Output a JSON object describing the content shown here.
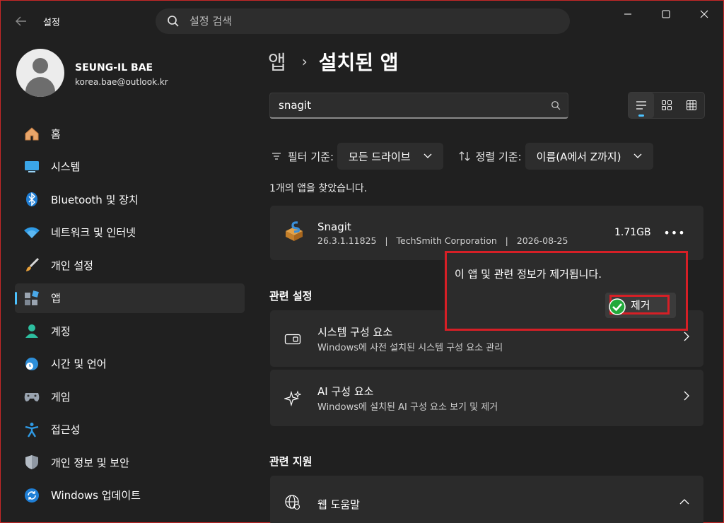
{
  "titlebar": {
    "app_title": "설정",
    "search_placeholder": "설정 검색"
  },
  "profile": {
    "name": "SEUNG-IL BAE",
    "email": "korea.bae@outlook.kr"
  },
  "sidebar": {
    "items": [
      {
        "label": "홈",
        "icon": "home-icon"
      },
      {
        "label": "시스템",
        "icon": "system-icon"
      },
      {
        "label": "Bluetooth 및 장치",
        "icon": "bluetooth-icon"
      },
      {
        "label": "네트워크 및 인터넷",
        "icon": "wifi-icon"
      },
      {
        "label": "개인 설정",
        "icon": "brush-icon"
      },
      {
        "label": "앱",
        "icon": "apps-icon",
        "active": true
      },
      {
        "label": "계정",
        "icon": "account-icon"
      },
      {
        "label": "시간 및 언어",
        "icon": "time-language-icon"
      },
      {
        "label": "게임",
        "icon": "gamepad-icon"
      },
      {
        "label": "접근성",
        "icon": "accessibility-icon"
      },
      {
        "label": "개인 정보 및 보안",
        "icon": "shield-icon"
      },
      {
        "label": "Windows 업데이트",
        "icon": "update-icon"
      }
    ]
  },
  "breadcrumb": {
    "parent": "앱",
    "separator": "›",
    "current": "설치된 앱"
  },
  "app_search": {
    "value": "snagit"
  },
  "filters": {
    "filter_label": "필터 기준:",
    "filter_value": "모든 드라이브",
    "sort_label": "정렬 기준:",
    "sort_value": "이름(A에서 Z까지)"
  },
  "results_text": "1개의 앱을 찾았습니다.",
  "app": {
    "name": "Snagit",
    "meta": "26.3.1.11825   |   TechSmith Corporation   |   2026-08-25",
    "size": "1.71GB",
    "more": "•••"
  },
  "related_settings": {
    "heading": "관련 설정",
    "items": [
      {
        "title": "시스템 구성 요소",
        "subtitle": "Windows에 사전 설치된 시스템 구성 요소 관리",
        "icon": "system-components-icon"
      },
      {
        "title": "AI 구성 요소",
        "subtitle": "Windows에 설치된 AI 구성 요소 보기 및 제거",
        "icon": "ai-sparkle-icon"
      }
    ]
  },
  "related_support": {
    "heading": "관련 지원",
    "items": [
      {
        "title": "웹 도움말",
        "icon": "web-globe-icon"
      }
    ]
  },
  "popup": {
    "message": "이 앱 및 관련 정보가 제거됩니다.",
    "button": "제거"
  },
  "colors": {
    "accent": "#4cc2ff",
    "highlight_red": "#d61f26",
    "background": "#202020",
    "card": "#2b2b2b"
  }
}
